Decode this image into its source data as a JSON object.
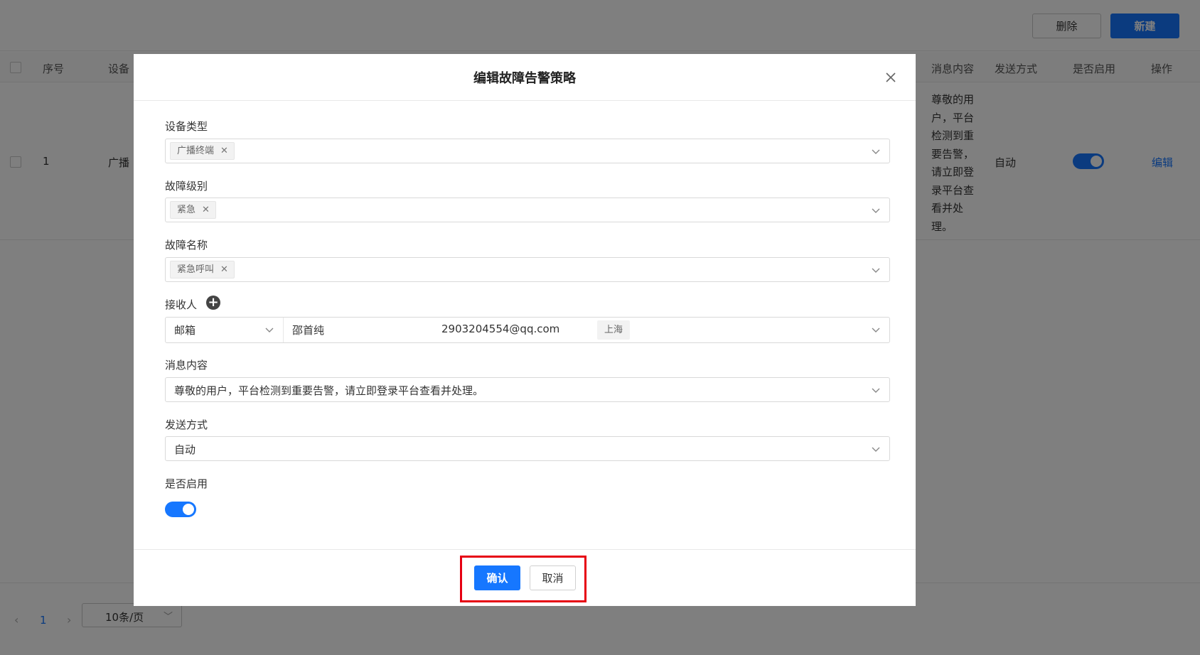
{
  "toolbar": {
    "delete_label": "删除",
    "new_label": "新建"
  },
  "table": {
    "headers": {
      "index": "序号",
      "device_partial": "设备",
      "message": "消息内容",
      "send_method": "发送方式",
      "enabled": "是否启用",
      "action": "操作"
    },
    "row": {
      "index": "1",
      "device_partial": "广播",
      "message": "尊敬的用户，平台检测到重要告警，请立即登录平台查看并处理。",
      "send_method": "自动",
      "enabled": true,
      "action": "编辑"
    }
  },
  "pagination": {
    "page": "1",
    "page_size": "10条/页"
  },
  "modal": {
    "title": "编辑故障告警策略",
    "device_type": {
      "label": "设备类型",
      "tag": "广播终端"
    },
    "fault_level": {
      "label": "故障级别",
      "tag": "紧急"
    },
    "fault_name": {
      "label": "故障名称",
      "tag": "紧急呼叫"
    },
    "receiver": {
      "label": "接收人",
      "method": "邮箱",
      "name": "邵首纯",
      "email": "2903204554@qq.com",
      "region_tag": "上海"
    },
    "message": {
      "label": "消息内容",
      "value": "尊敬的用户，平台检测到重要告警，请立即登录平台查看并处理。"
    },
    "send_method": {
      "label": "发送方式",
      "value": "自动"
    },
    "enabled": {
      "label": "是否启用",
      "value": true
    },
    "confirm_label": "确认",
    "cancel_label": "取消"
  },
  "colors": {
    "primary": "#1677ff",
    "highlight": "#e60012"
  }
}
